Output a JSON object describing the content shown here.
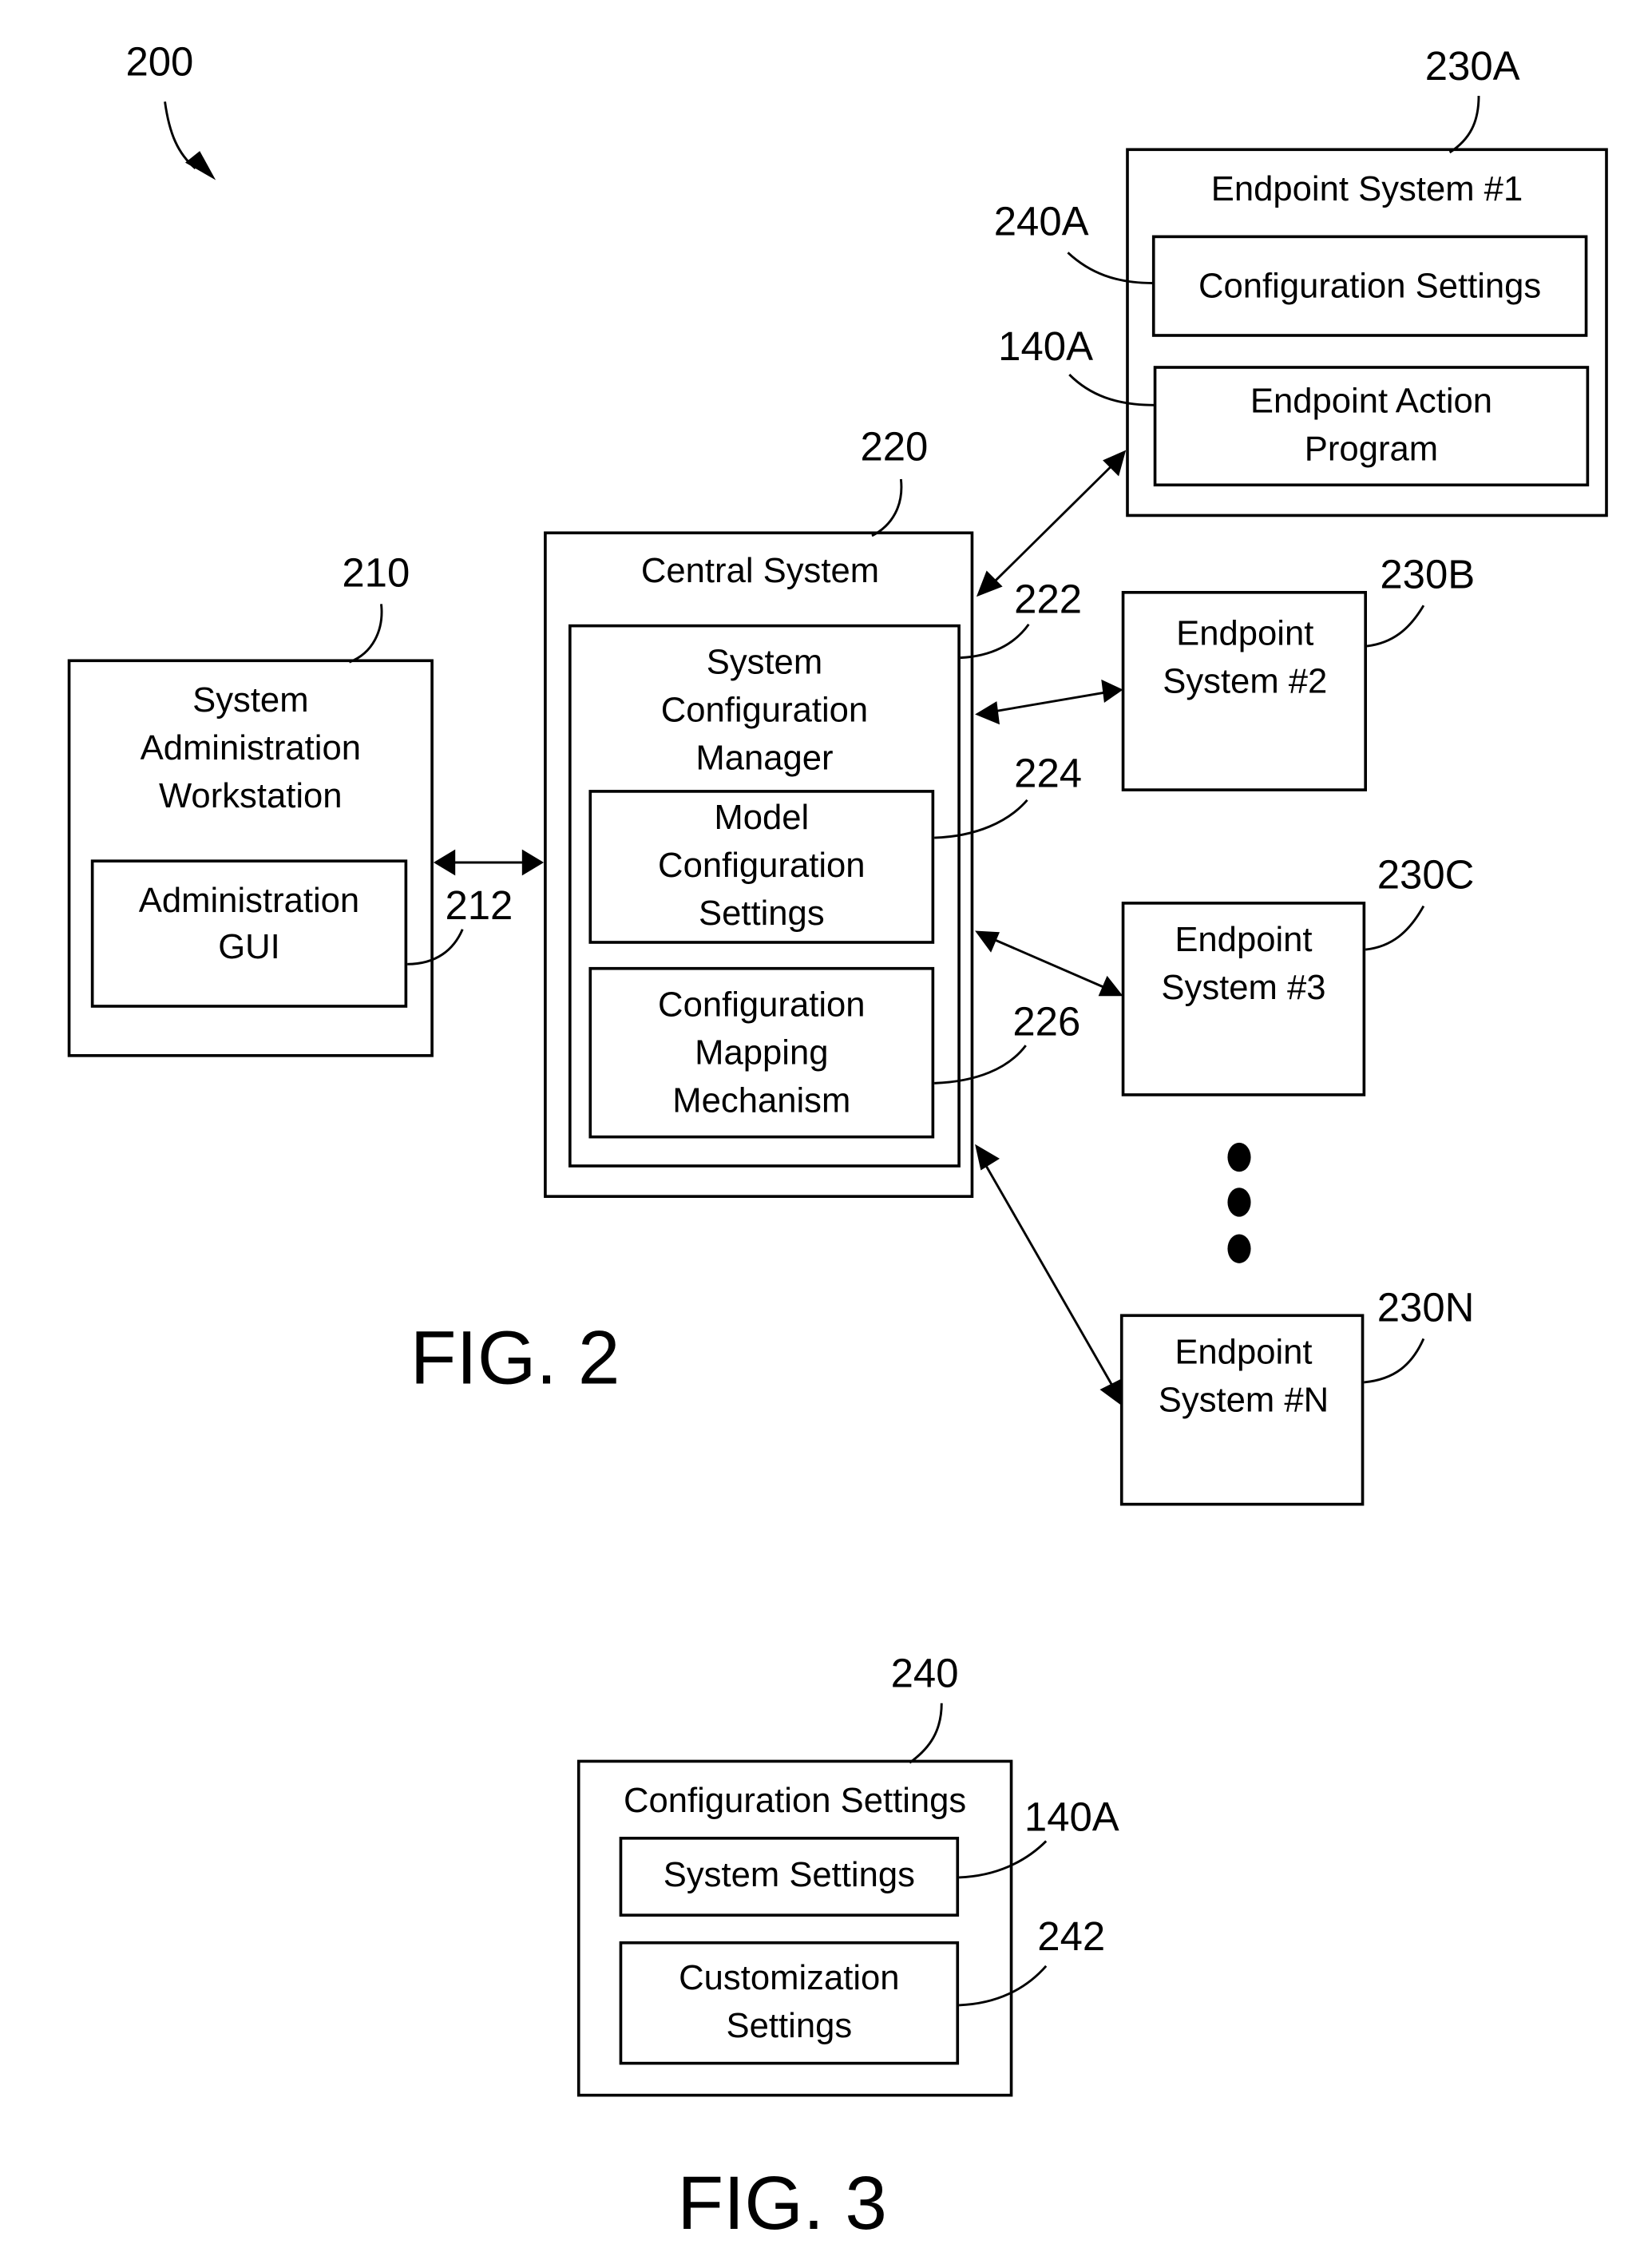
{
  "fig2": {
    "ref": "200",
    "caption": "FIG. 2",
    "workstation": {
      "ref": "210",
      "title": [
        "System",
        "Administration",
        "Workstation"
      ],
      "gui": {
        "ref": "212",
        "label": [
          "Administration",
          "GUI"
        ]
      }
    },
    "central": {
      "ref": "220",
      "title": "Central System",
      "manager": {
        "ref": "222",
        "title": [
          "System",
          "Configuration",
          "Manager"
        ],
        "model": {
          "ref": "224",
          "label": [
            "Model",
            "Configuration",
            "Settings"
          ]
        },
        "mapping": {
          "ref": "226",
          "label": [
            "Configuration",
            "Mapping",
            "Mechanism"
          ]
        }
      }
    },
    "endpoints": [
      {
        "ref": "230A",
        "title": "Endpoint System #1",
        "config": {
          "ref": "240A",
          "label": "Configuration Settings"
        },
        "action": {
          "ref": "140A",
          "label": [
            "Endpoint Action",
            "Program"
          ]
        }
      },
      {
        "ref": "230B",
        "title": [
          "Endpoint",
          "System #2"
        ]
      },
      {
        "ref": "230C",
        "title": [
          "Endpoint",
          "System #3"
        ]
      },
      {
        "ref": "230N",
        "title": [
          "Endpoint",
          "System #N"
        ]
      }
    ],
    "ellipsis": "more-endpoints"
  },
  "fig3": {
    "caption": "FIG. 3",
    "settings": {
      "ref": "240",
      "title": "Configuration Settings",
      "system": {
        "ref": "140A",
        "label": "System Settings"
      },
      "custom": {
        "ref": "242",
        "label": [
          "Customization",
          "Settings"
        ]
      }
    }
  }
}
